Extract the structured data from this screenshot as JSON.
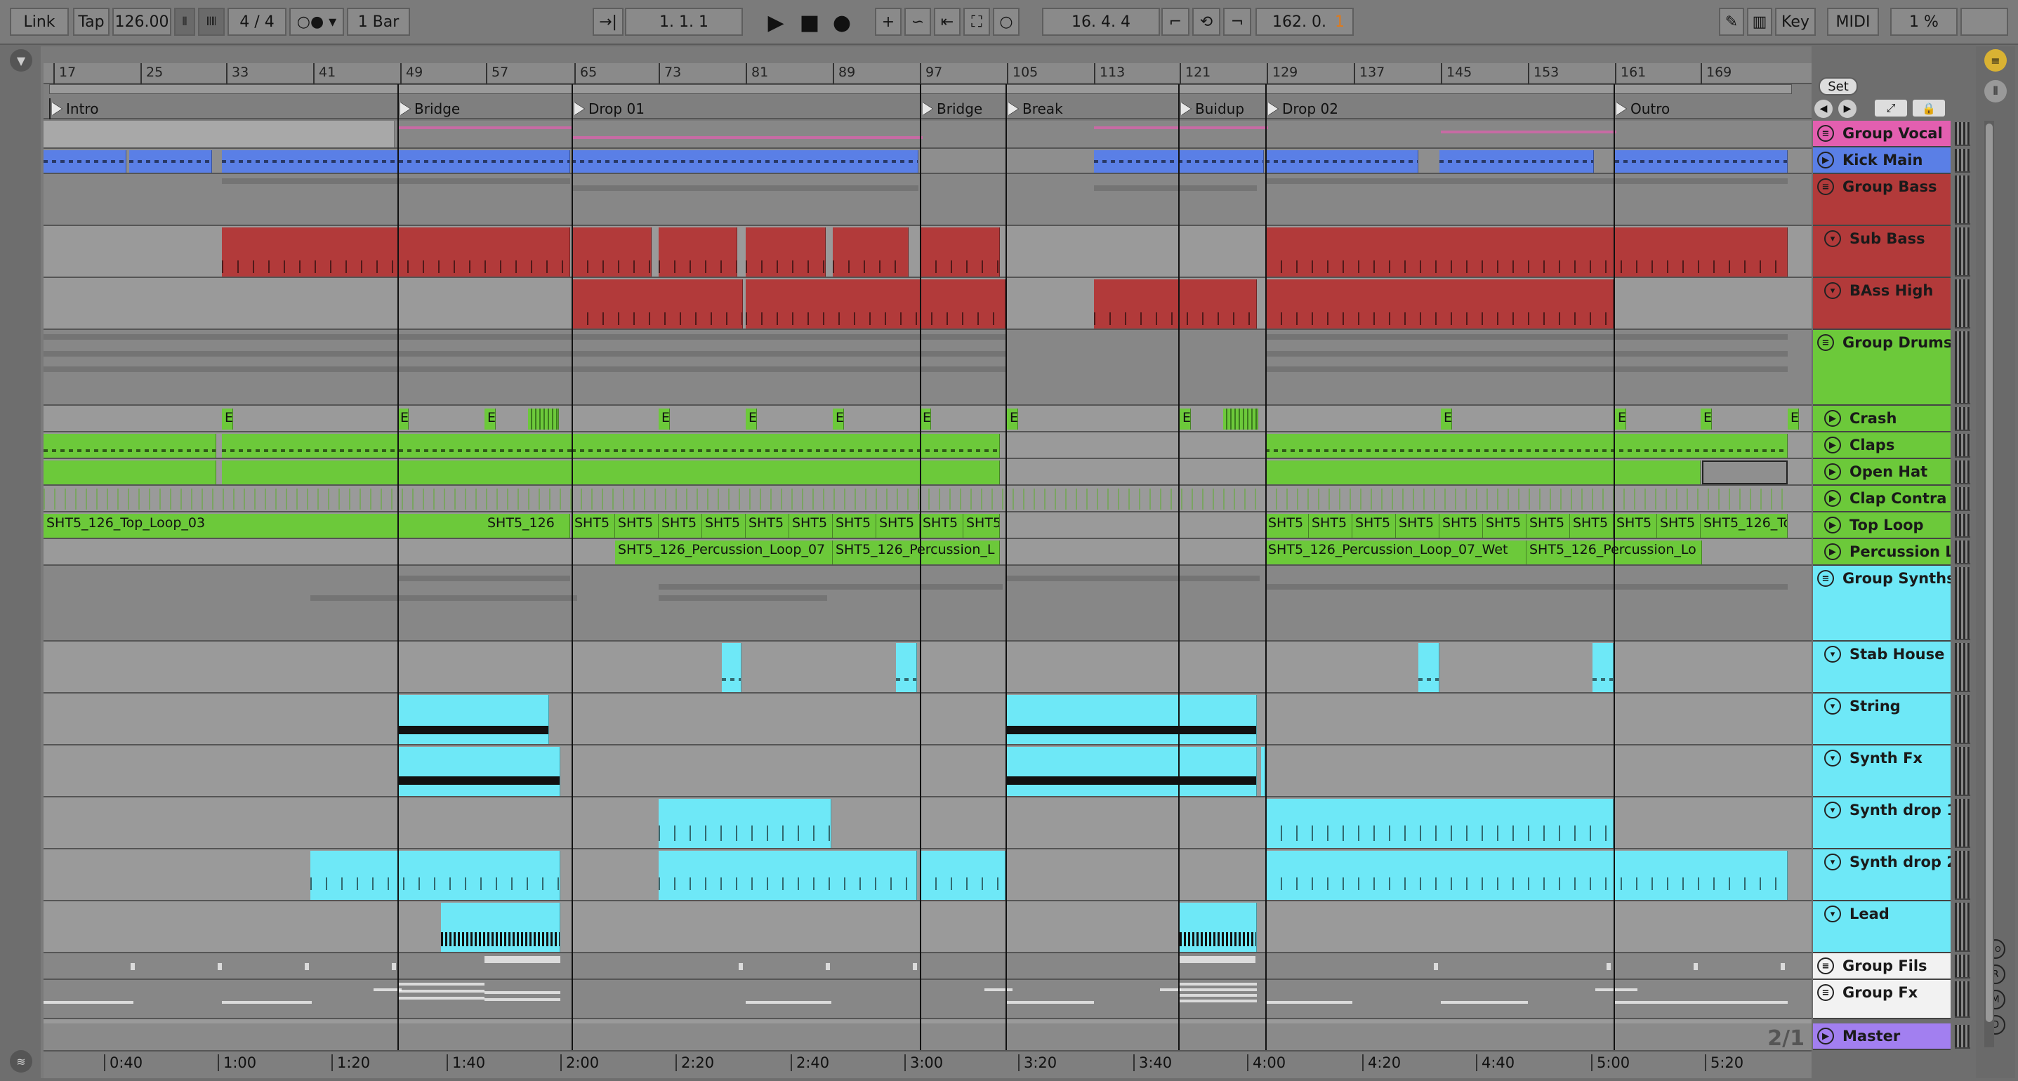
{
  "control_bar": {
    "link": "Link",
    "tap": "Tap",
    "tempo": "126.00",
    "signature": "4 / 4",
    "quantize": "1 Bar",
    "position": "1.   1.   1",
    "loop_start": "16.   4.   4",
    "loop_length": "162.   0.",
    "loop_length_frac": "1",
    "key": "Key",
    "midi": "MIDI",
    "cpu": "1 %"
  },
  "ruler": {
    "bars": [
      "17",
      "25",
      "33",
      "41",
      "49",
      "57",
      "65",
      "73",
      "81",
      "89",
      "97",
      "105",
      "113",
      "121",
      "129",
      "137",
      "145",
      "153",
      "161",
      "169"
    ]
  },
  "locators": [
    "Intro",
    "Bridge",
    "Drop 01",
    "Bridge",
    "Break",
    "Buidup",
    "Drop 02",
    "Outro"
  ],
  "set_button": "Set",
  "time_ruler": [
    "0:40",
    "1:00",
    "1:20",
    "1:40",
    "2:00",
    "2:20",
    "2:40",
    "3:00",
    "3:20",
    "3:40",
    "4:00",
    "4:20",
    "4:40",
    "5:00",
    "5:20"
  ],
  "page_indicator": "2/1",
  "tracks": [
    "Group Vocal",
    "Kick Main",
    "Group Bass",
    "Sub Bass",
    "BAss High",
    "Group Drums",
    "Crash",
    "Claps",
    "Open Hat",
    "Clap Contra",
    "Top Loop",
    "Percussion Lo",
    "Group Synths",
    "Stab House",
    "String",
    "Synth Fx",
    "Synth drop 1",
    "Synth drop 2",
    "Lead",
    "Group Fils",
    "Group Fx",
    "Master"
  ],
  "clip_labels": {
    "top_loop_main": "SHT5_126_Top_Loop_03",
    "top_loop_short": "SHT5_126",
    "top_loop_seg": "SHT5",
    "top_loop_outro": "SHT5_126_Top_Lo",
    "perc_loop_a": "SHT5_126_Percussion_Loop_07",
    "perc_loop_b": "SHT5_126_Percussion_L",
    "perc_loop_c": "SHT5_126_Percussion_Loop_07_Wet",
    "perc_loop_d": "SHT5_126_Percussion_Lo",
    "crash_clip": "E"
  },
  "side_io": [
    "I·O",
    "R",
    "M",
    "D"
  ],
  "colors": {
    "vocal": "#e35fb0",
    "kick": "#5a7fe6",
    "bass": "#b23a3a",
    "drums": "#6cc93a",
    "synths": "#6ee8f7",
    "fills": "#f2f2f2",
    "master": "#a27ff0"
  }
}
